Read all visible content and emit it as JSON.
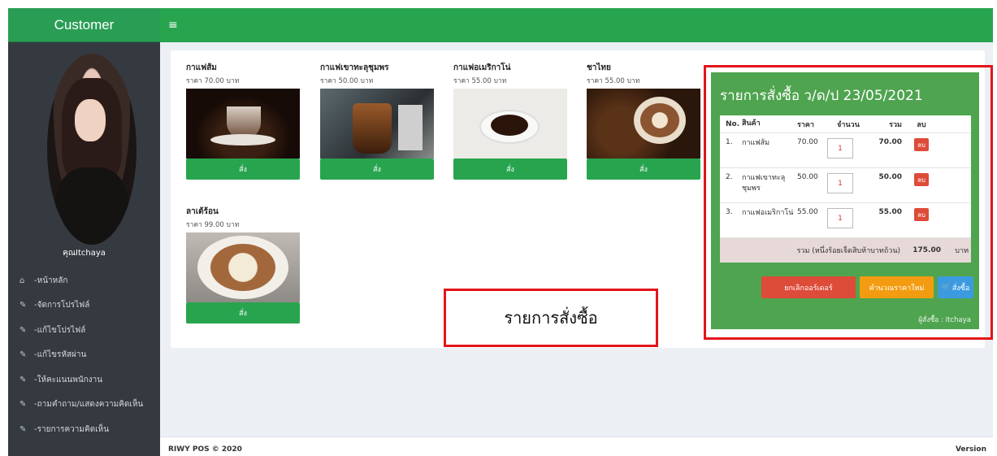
{
  "sidebar": {
    "brand": "Customer",
    "username": "คุณItchaya",
    "items": [
      {
        "icon": "home-icon",
        "glyph": "⌂",
        "label": "-หน้าหลัก"
      },
      {
        "icon": "edit-icon",
        "glyph": "✎",
        "label": "-จัดการโปรไฟล์"
      },
      {
        "icon": "edit-icon",
        "glyph": "✎",
        "label": "-แก้ไขโปรไฟล์"
      },
      {
        "icon": "edit-icon",
        "glyph": "✎",
        "label": "-แก้ไขรหัสผ่าน"
      },
      {
        "icon": "edit-icon",
        "glyph": "✎",
        "label": "-ให้คะแนนพนักงาน"
      },
      {
        "icon": "edit-icon",
        "glyph": "✎",
        "label": "-ถามคำถาม/แสดงความคิดเห็น"
      },
      {
        "icon": "edit-icon",
        "glyph": "✎",
        "label": "-รายการความคิดเห็น"
      }
    ]
  },
  "topbar": {
    "menu_glyph": "≡"
  },
  "products": [
    {
      "name": "กาแฟส้ม",
      "price": "ราคา 70.00 บาท",
      "order": "สั่ง"
    },
    {
      "name": "กาแฟเขาทะลุชุมพร",
      "price": "ราคา 50.00 บาท",
      "order": "สั่ง"
    },
    {
      "name": "กาแฟอเมริกาโน่",
      "price": "ราคา 55.00 บาท",
      "order": "สั่ง"
    },
    {
      "name": "ชาไทย",
      "price": "ราคา 55.00 บาท",
      "order": "สั่ง"
    },
    {
      "name": "ลาเต้ร้อน",
      "price": "ราคา 99.00 บาท",
      "order": "สั่ง"
    }
  ],
  "cart": {
    "title": "รายการสั่งซื้อ ว/ด/ป 23/05/2021",
    "headers": {
      "no": "No.",
      "name": "สินค้า",
      "price": "ราคา",
      "qty": "จำนวน",
      "sum": "รวม",
      "del": "ลบ"
    },
    "rows": [
      {
        "no": "1.",
        "name": "กาแฟส้ม",
        "price": "70.00",
        "qty": "1",
        "sum": "70.00",
        "del": "ลบ"
      },
      {
        "no": "2.",
        "name": "กาแฟเขาทะลุชุมพร",
        "price": "50.00",
        "qty": "1",
        "sum": "50.00",
        "del": "ลบ"
      },
      {
        "no": "3.",
        "name": "กาแฟอเมริกาโน่",
        "price": "55.00",
        "qty": "1",
        "sum": "55.00",
        "del": "ลบ"
      }
    ],
    "total_label": "รวม (หนึ่งร้อยเจ็ดสิบห้าบาทถ้วน)",
    "total_value": "175.00",
    "total_unit": "บาท",
    "cancel_label": "ยกเลิกออร์เดอร์",
    "recalc_label": "คำนวณราคาใหม่",
    "buy_label": "สั่งซื้อ",
    "orderer": "ผู้สั่งซื้อ : Itchaya"
  },
  "annotation": "รายการสั่งซื้อ",
  "footer": {
    "copyright": "RIWY POS © 2020",
    "version": "Version"
  },
  "colors": {
    "accent": "#28a44f",
    "cart_bg": "#4fa44f",
    "annotation": "#e3151a",
    "sidebar": "#343a40"
  }
}
